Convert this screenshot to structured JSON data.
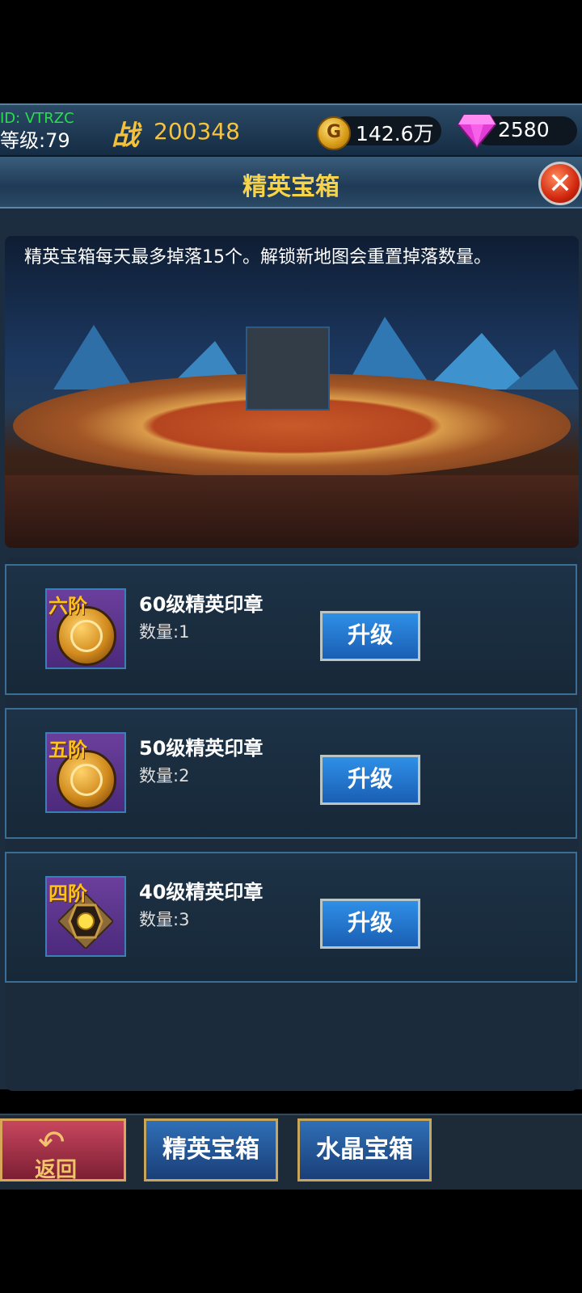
{
  "status": {
    "id_label": "ID: VTRZC",
    "level_label": "等级:79",
    "battle_icon_text": "战",
    "power": "200348",
    "gold": "142.6万",
    "gold_icon_text": "G",
    "gems": "2580"
  },
  "header": {
    "title": "精英宝箱",
    "close_symbol": "✕"
  },
  "banner": {
    "notice": "精英宝箱每天最多掉落15个。解锁新地图会重置掉落数量。"
  },
  "items": [
    {
      "tier": "六阶",
      "name": "60级精英印章",
      "quantity": "数量:1",
      "button": "升级"
    },
    {
      "tier": "五阶",
      "name": "50级精英印章",
      "quantity": "数量:2",
      "button": "升级"
    },
    {
      "tier": "四阶",
      "name": "40级精英印章",
      "quantity": "数量:3",
      "button": "升级"
    }
  ],
  "footer": {
    "back_label": "返回",
    "back_arrow": "↶",
    "tabs": [
      "精英宝箱",
      "水晶宝箱"
    ]
  },
  "colors": {
    "gold_text": "#f3c341",
    "tier_text": "#ffc21a",
    "button_blue": "#1a5fb4",
    "id_green": "#27e04a"
  }
}
